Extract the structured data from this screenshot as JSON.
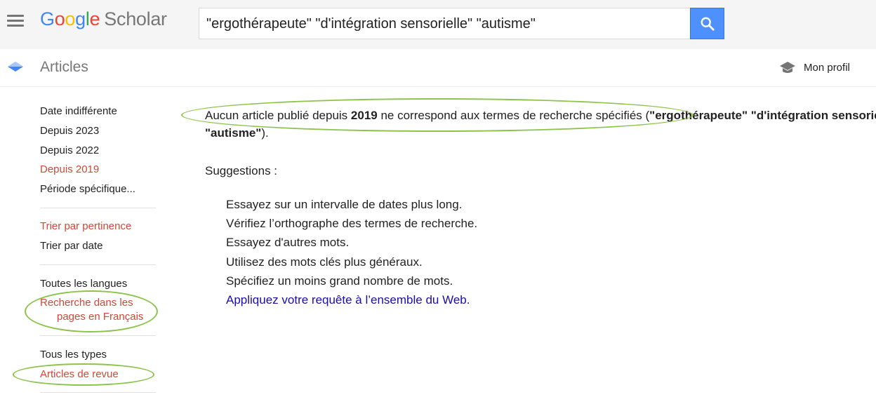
{
  "header": {
    "menu_icon": "hamburger-menu-icon",
    "logo": {
      "google_letters": [
        "G",
        "o",
        "o",
        "g",
        "l",
        "e"
      ],
      "product": "Scholar"
    },
    "search": {
      "value": "\"ergothérapeute\" \"d'intégration sensorielle\" \"autisme\"",
      "button_icon": "search-icon"
    }
  },
  "subheader": {
    "section_icon": "articles-icon",
    "title": "Articles",
    "profile_icon": "graduation-cap-icon",
    "profile_label": "Mon profil"
  },
  "sidebar": {
    "date_filters": [
      {
        "label": "Date indifférente",
        "active": false
      },
      {
        "label": "Depuis 2023",
        "active": false
      },
      {
        "label": "Depuis 2022",
        "active": false
      },
      {
        "label": "Depuis 2019",
        "active": true
      },
      {
        "label": "Période spécifique...",
        "active": false
      }
    ],
    "sort_options": [
      {
        "label": "Trier par pertinence",
        "active": true
      },
      {
        "label": "Trier par date",
        "active": false
      }
    ],
    "language_options": [
      {
        "label": "Toutes les langues",
        "active": false
      },
      {
        "label_line1": "Recherche dans les",
        "label_line2": "pages en Français",
        "active": true
      }
    ],
    "type_options": [
      {
        "label": "Tous les types",
        "active": false
      },
      {
        "label": "Articles de revue",
        "active": true
      }
    ]
  },
  "main": {
    "message": {
      "prefix": "Aucun article publié depuis ",
      "year": "2019",
      "middle": " ne correspond aux termes de recherche spécifiés (",
      "terms_line1": "\"ergothérapeute\" \"d'intégration sensorielle\"",
      "terms_line2": "\"autisme\"",
      "suffix": ")."
    },
    "suggestions_title": "Suggestions :",
    "suggestions": [
      "Essayez sur un intervalle de dates plus long.",
      "Vérifiez l’orthographe des termes de recherche.",
      "Essayez d'autres mots.",
      "Utilisez des mots clés plus généraux.",
      "Spécifiez un moins grand nombre de mots."
    ],
    "web_link": "Appliquez votre requête à l’ensemble du Web."
  },
  "annotations": {
    "highlight_color": "#8cc34a"
  }
}
